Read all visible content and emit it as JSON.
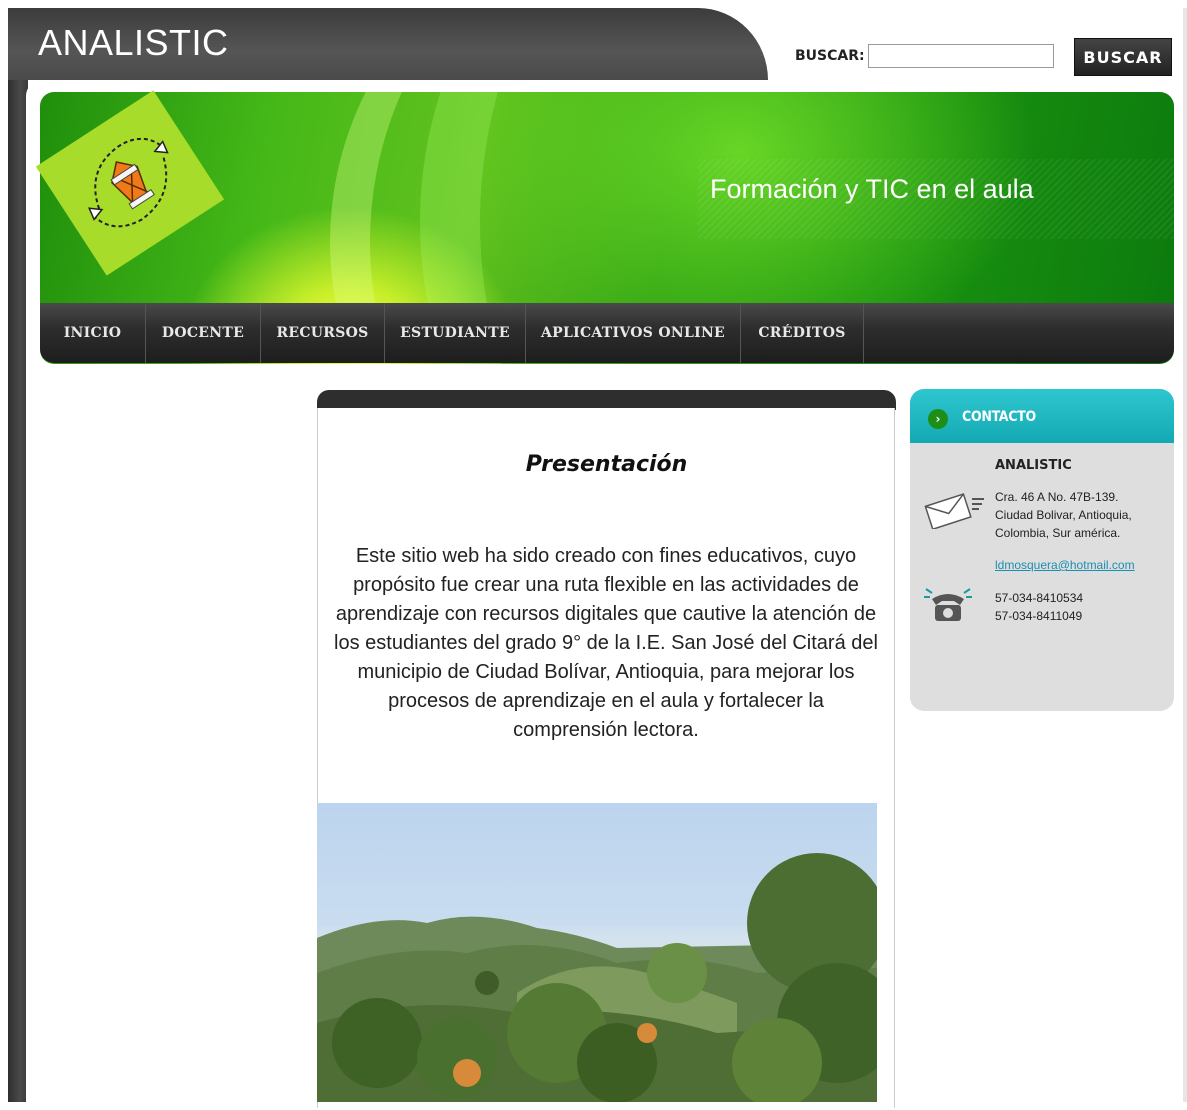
{
  "header": {
    "site_title": "ANALISTIC",
    "search_label": "BUSCAR:",
    "search_value": "",
    "search_button": "BUSCAR"
  },
  "banner": {
    "tagline": "Formación y TIC en el aula",
    "logo_icon": "analistic-logo"
  },
  "nav": {
    "items": [
      {
        "label": "INICIO"
      },
      {
        "label": "DOCENTE"
      },
      {
        "label": "RECURSOS"
      },
      {
        "label": "ESTUDIANTE"
      },
      {
        "label": "APLICATIVOS ONLINE"
      },
      {
        "label": "CRÉDITOS"
      }
    ]
  },
  "main": {
    "title": "Presentación",
    "paragraph": "Este sitio web ha sido creado con fines educativos, cuyo propósito fue crear una ruta flexible en las actividades de aprendizaje con recursos digitales que cautive la atención de los estudiantes del grado 9° de la I.E. San José del Citará del municipio de Ciudad Bolívar, Antioquia, para mejorar los procesos de aprendizaje en el aula y fortalecer la comprensión lectora."
  },
  "contact": {
    "title": "CONTACTO",
    "name": "ANALISTIC",
    "address_line1": "Cra. 46 A No. 47B-139.",
    "address_line2": "Ciudad Bolivar, Antioquia,",
    "address_line3": "Colombia, Sur américa.",
    "email": "ldmosquera@hotmail.com",
    "phone1": "57-034-8410534",
    "phone2": "57-034-8411049"
  },
  "colors": {
    "frame": "#3c3c3c",
    "banner_green": "#1f8f0c",
    "contact_header": "#13a9b2",
    "nav_bg": "#2e2e2e"
  }
}
